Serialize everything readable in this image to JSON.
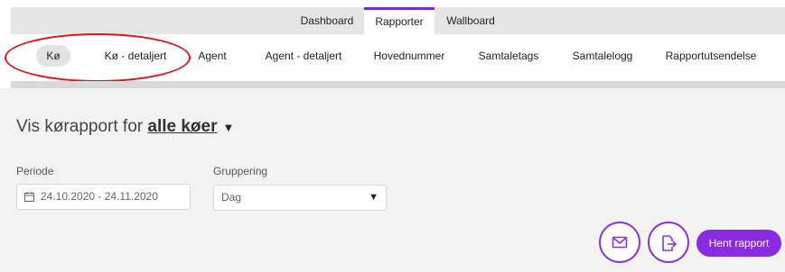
{
  "tabs": [
    {
      "label": "Dashboard",
      "active": false
    },
    {
      "label": "Rapporter",
      "active": true
    },
    {
      "label": "Wallboard",
      "active": false
    }
  ],
  "subnav": [
    {
      "label": "Kø",
      "selected": true
    },
    {
      "label": "Kø - detaljert",
      "selected": false
    },
    {
      "label": "Agent",
      "selected": false
    },
    {
      "label": "Agent - detaljert",
      "selected": false
    },
    {
      "label": "Hovednummer",
      "selected": false
    },
    {
      "label": "Samtaletags",
      "selected": false
    },
    {
      "label": "Samtalelogg",
      "selected": false
    },
    {
      "label": "Rapportutsendelse",
      "selected": false
    }
  ],
  "heading": {
    "prefix": "Vis kørapport for",
    "queue": "alle køer"
  },
  "period": {
    "label": "Periode",
    "value": "24.10.2020 - 24.11.2020",
    "icon": "calendar-icon"
  },
  "grouping": {
    "label": "Gruppering",
    "value": "Dag"
  },
  "actions": {
    "email_icon": "envelope-icon",
    "export_icon": "file-export-icon",
    "fetch_label": "Hent rapport"
  },
  "colors": {
    "accent": "#8a2be2",
    "annotation": "#e3121b",
    "background": "#f3f3f3"
  }
}
